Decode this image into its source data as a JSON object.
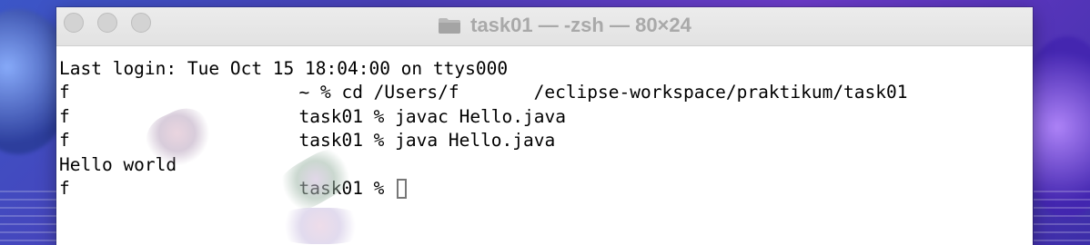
{
  "window": {
    "title": "task01 — -zsh — 80×24",
    "title_icon": "folder-icon",
    "traffic_lights": [
      "close",
      "minimize",
      "zoom"
    ]
  },
  "terminal": {
    "lines": [
      {
        "text": "Last login: Tue Oct 15 18:04:00 on ttys000"
      },
      {
        "prefix": "f",
        "suffix": " ~ % cd /Users/f",
        "mid": "/eclipse-workspace/praktikum/task01"
      },
      {
        "prefix": "f",
        "suffix": " task01 % javac Hello.java"
      },
      {
        "prefix": "f",
        "suffix": " task01 % java Hello.java"
      },
      {
        "text": "Hello world"
      },
      {
        "prefix": "f",
        "suffix": " task01 % "
      }
    ]
  },
  "colors": {
    "title_text": "#a9a9a9",
    "terminal_bg": "#ffffff",
    "terminal_text": "#000000"
  }
}
